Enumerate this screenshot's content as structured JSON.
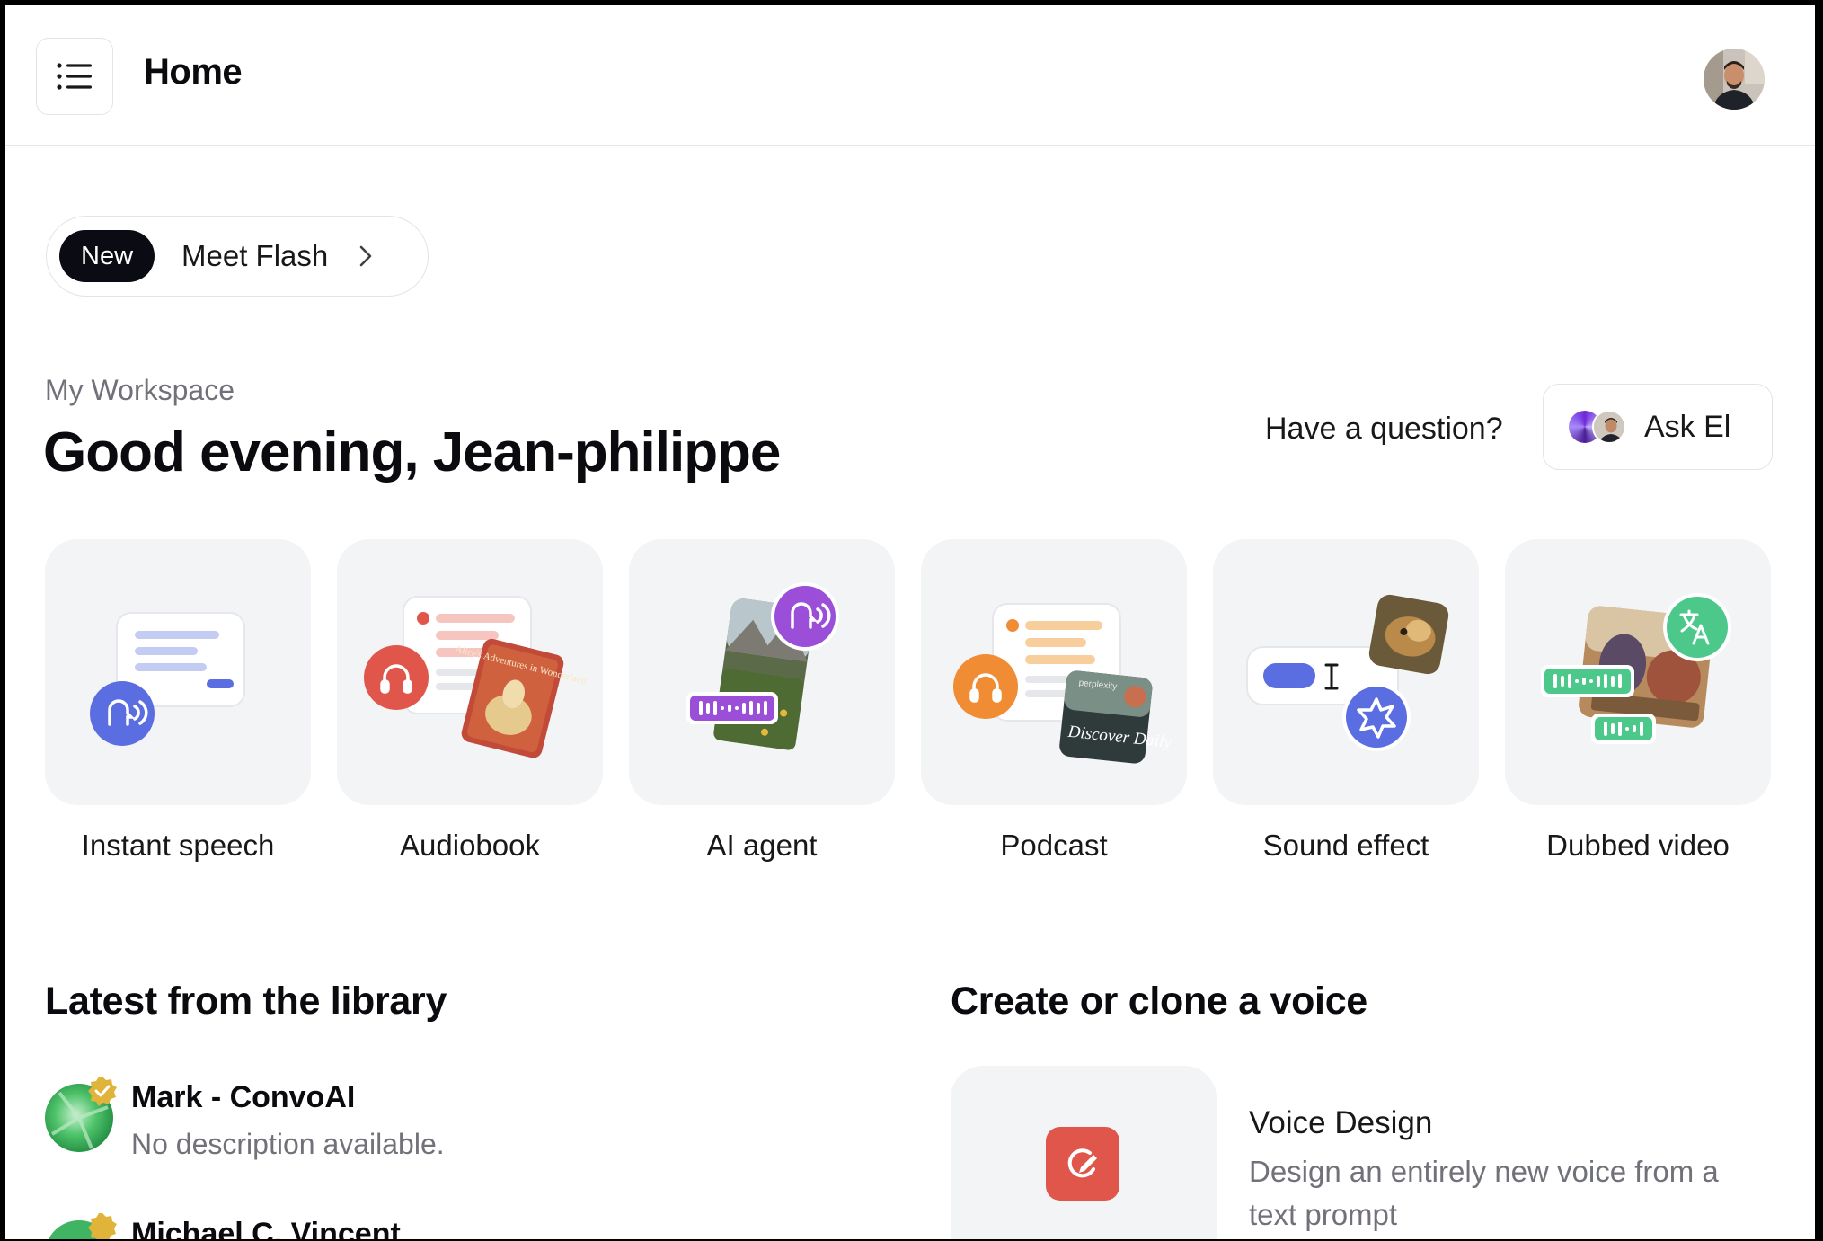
{
  "header": {
    "title": "Home"
  },
  "announcement": {
    "badge": "New",
    "text": "Meet Flash"
  },
  "workspace": {
    "label": "My Workspace",
    "greeting": "Good evening, Jean-philippe",
    "question": "Have a question?",
    "ask_label": "Ask El"
  },
  "cards": [
    {
      "label": "Instant speech"
    },
    {
      "label": "Audiobook",
      "book_text": "Alice's Adventures in Wonderland"
    },
    {
      "label": "AI agent"
    },
    {
      "label": "Podcast",
      "cover_text": "Discover Daily",
      "brand_text": "perplexity"
    },
    {
      "label": "Sound effect"
    },
    {
      "label": "Dubbed video"
    }
  ],
  "library": {
    "title": "Latest from the library",
    "items": [
      {
        "name": "Mark - ConvoAI",
        "description": "No description available."
      },
      {
        "name": "Michael C. Vincent",
        "description": ""
      }
    ]
  },
  "create": {
    "title": "Create or clone a voice",
    "voice_design": {
      "title": "Voice Design",
      "description": "Design an entirely new voice from a text prompt"
    }
  },
  "colors": {
    "tile_bg": "#f3f4f6",
    "blue": "#5b6ee1",
    "red": "#e0564a",
    "purple": "#9b4fd9",
    "orange": "#ef8c34",
    "green": "#4cc98a"
  }
}
